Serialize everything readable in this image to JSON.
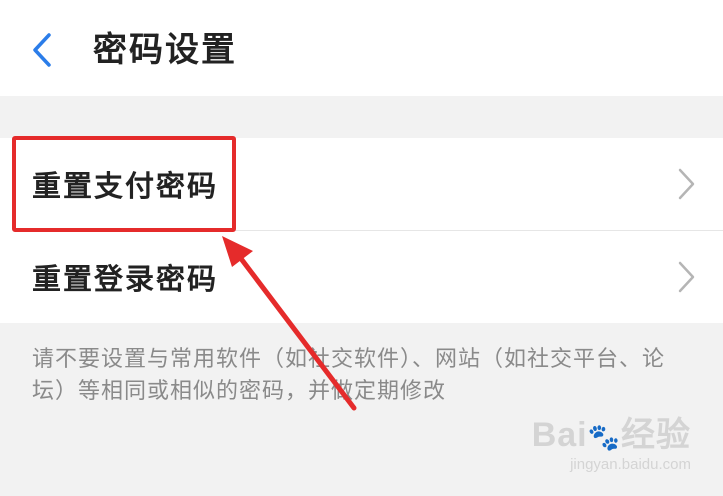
{
  "header": {
    "back_icon": "chevron-left-icon",
    "title": "密码设置",
    "accent_color": "#2b7de9"
  },
  "list": {
    "items": [
      {
        "label": "重置支付密码",
        "icon": "chevron-right-icon",
        "highlighted": true
      },
      {
        "label": "重置登录密码",
        "icon": "chevron-right-icon",
        "highlighted": false
      }
    ]
  },
  "footnote": {
    "text": "请不要设置与常用软件（如社交软件）、网站（如社交平台、论坛）等相同或相似的密码，并做定期修改"
  },
  "annotation": {
    "highlight_color": "#e52b2b"
  },
  "watermark": {
    "logo_prefix": "Bai",
    "logo_suffix": "经验",
    "url": "jingyan.baidu.com"
  }
}
